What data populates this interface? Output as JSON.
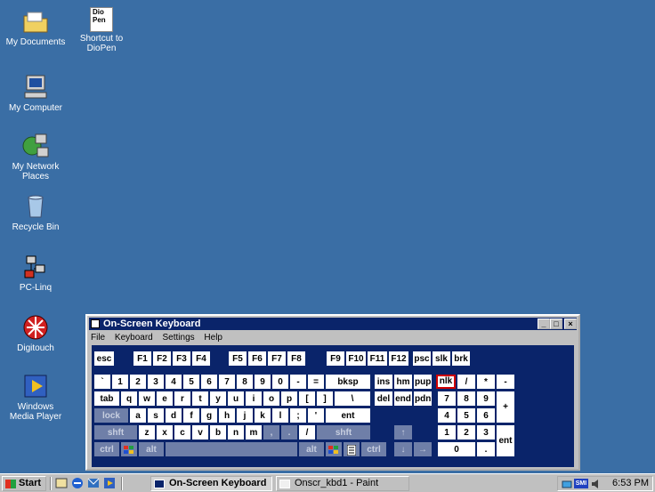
{
  "desktop": {
    "icons": [
      {
        "label_line1": "My Documents",
        "label_line2": ""
      },
      {
        "label_line1": "Shortcut to",
        "label_line2": "DioPen"
      },
      {
        "label_line1": "My Computer",
        "label_line2": ""
      },
      {
        "label_line1": "My Network",
        "label_line2": "Places"
      },
      {
        "label_line1": "Recycle Bin",
        "label_line2": ""
      },
      {
        "label_line1": "PC-Linq",
        "label_line2": ""
      },
      {
        "label_line1": "Digitouch",
        "label_line2": ""
      },
      {
        "label_line1": "Windows",
        "label_line2": "Media Player"
      }
    ],
    "diopen_icon_text_1": "Dio",
    "diopen_icon_text_2": "Pen"
  },
  "osk": {
    "title": "On-Screen Keyboard",
    "menu": {
      "file": "File",
      "keyboard": "Keyboard",
      "settings": "Settings",
      "help": "Help"
    },
    "title_buttons": {
      "minimize": "_",
      "maximize": "□",
      "close": "×"
    },
    "keys": {
      "esc": "esc",
      "f1": "F1",
      "f2": "F2",
      "f3": "F3",
      "f4": "F4",
      "f5": "F5",
      "f6": "F6",
      "f7": "F7",
      "f8": "F8",
      "f9": "F9",
      "f10": "F10",
      "f11": "F11",
      "f12": "F12",
      "psc": "psc",
      "slk": "slk",
      "brk": "brk",
      "backtick": "`",
      "n1": "1",
      "n2": "2",
      "n3": "3",
      "n4": "4",
      "n5": "5",
      "n6": "6",
      "n7": "7",
      "n8": "8",
      "n9": "9",
      "n0": "0",
      "minus": "-",
      "equals": "=",
      "bksp": "bksp",
      "ins": "ins",
      "hm": "hm",
      "pup": "pup",
      "nlk": "nlk",
      "np_div": "/",
      "np_mul": "*",
      "np_sub": "-",
      "tab": "tab",
      "q": "q",
      "w": "w",
      "e": "e",
      "r": "r",
      "t": "t",
      "y": "y",
      "u": "u",
      "i": "i",
      "o": "o",
      "p": "p",
      "lbr": "[",
      "rbr": "]",
      "bslash": "\\",
      "del": "del",
      "end": "end",
      "pdn": "pdn",
      "np7": "7",
      "np8": "8",
      "np9": "9",
      "np_add": "+",
      "lock": "lock",
      "a": "a",
      "s": "s",
      "d": "d",
      "f": "f",
      "g": "g",
      "h": "h",
      "j": "j",
      "k": "k",
      "l": "l",
      "semi": ";",
      "quote": "'",
      "ent": "ent",
      "np4": "4",
      "np5": "5",
      "np6": "6",
      "lshft": "shft",
      "z": "z",
      "x": "x",
      "c": "c",
      "v": "v",
      "b": "b",
      "n": "n",
      "m": "m",
      "comma": ",",
      "period": ".",
      "slash": "/",
      "rshft": "shft",
      "up": "↑",
      "np1": "1",
      "np2": "2",
      "np3": "3",
      "np_ent": "ent",
      "lctrl": "ctrl",
      "lalt": "alt",
      "ralt": "alt",
      "rctrl": "ctrl",
      "left": "←",
      "down": "↓",
      "right": "→",
      "np0": "0",
      "np_dot": "."
    }
  },
  "taskbar": {
    "start": "Start",
    "tasks": [
      {
        "label": "On-Screen Keyboard",
        "active": true
      },
      {
        "label": "Onscr_kbd1 - Paint",
        "active": false
      }
    ],
    "clock": "6:53 PM",
    "tray_badge": "SMI"
  },
  "colors": {
    "desktop": "#3a6ea5",
    "title_bar": "#0a246a",
    "keyboard_bg": "#0a246a",
    "key_active": "#ffffff",
    "key_dim": "#6f7fa8",
    "key_highlight_border": "#d00000"
  }
}
